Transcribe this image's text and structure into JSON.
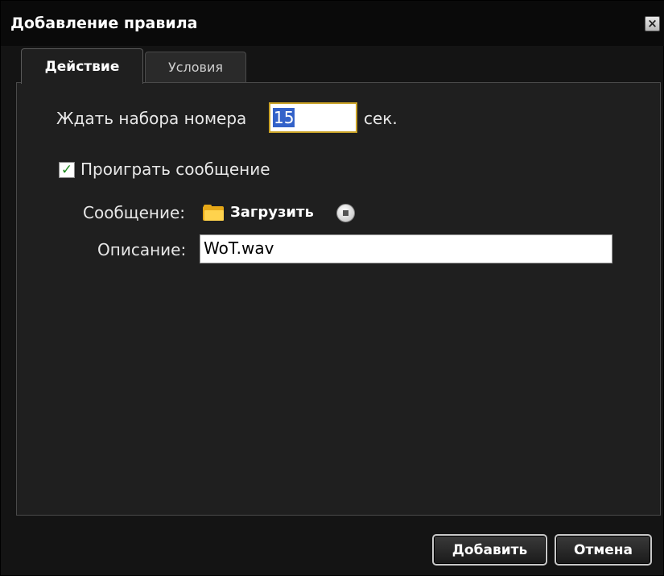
{
  "dialog": {
    "title": "Добавление правила",
    "close_icon": "close-icon"
  },
  "tabs": [
    {
      "label": "Действие",
      "active": true
    },
    {
      "label": "Условия",
      "active": false
    }
  ],
  "form": {
    "wait_label": "Ждать набора номера",
    "wait_value": "15",
    "wait_unit": "сек.",
    "play_checkbox_checked": true,
    "play_label": "Проиграть сообщение",
    "message_label": "Сообщение:",
    "upload_label": "Загрузить",
    "upload_icon": "folder-icon",
    "stop_icon": "stop-icon",
    "description_label": "Описание:",
    "description_value": "WoT.wav"
  },
  "buttons": {
    "add_label": "Добавить",
    "cancel_label": "Отмена"
  },
  "colors": {
    "background": "#141414",
    "panel": "#1f1f1f",
    "input_focus_border": "#c9a227",
    "selection": "#3362c9",
    "checkmark": "#1e8a1e",
    "folder": "#ffd34d"
  }
}
